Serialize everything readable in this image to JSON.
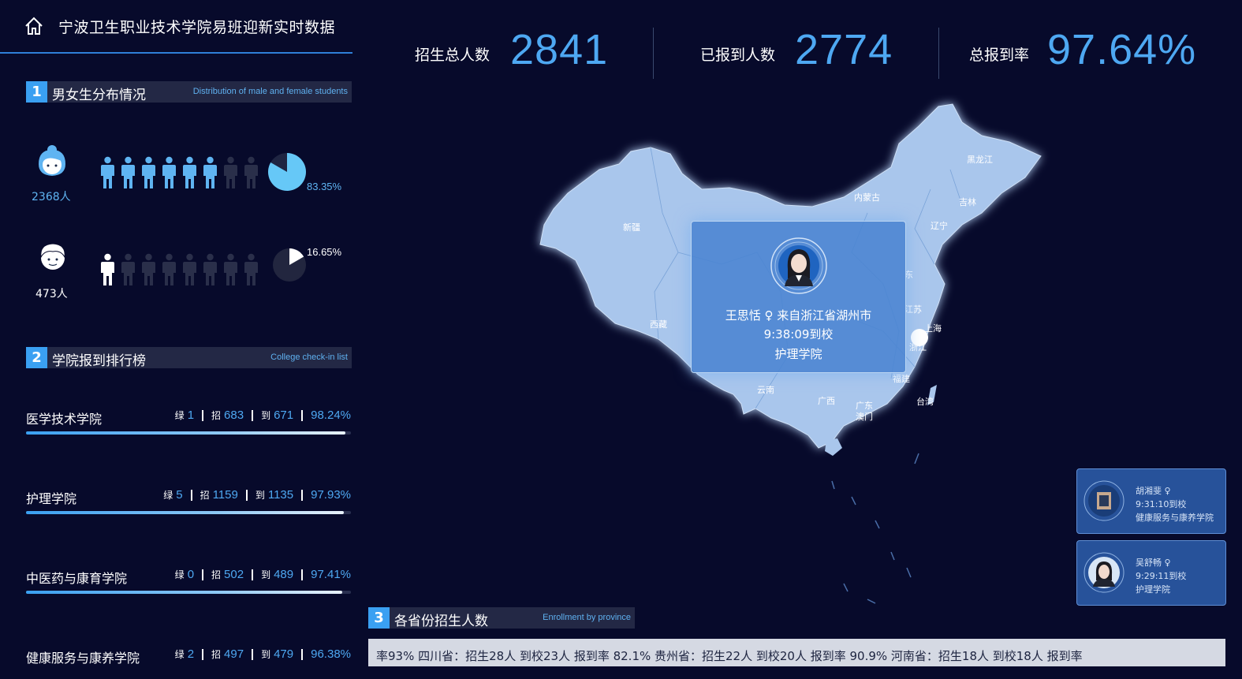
{
  "header": {
    "title": "宁波卫生职业技术学院易班迎新实时数据"
  },
  "kpis": [
    {
      "label": "招生总人数",
      "value": "2841"
    },
    {
      "label": "已报到人数",
      "value": "2774"
    },
    {
      "label": "总报到率",
      "value": "97.64%"
    }
  ],
  "section1": {
    "num": "1",
    "title": "男女生分布情况",
    "subtitle": "Distribution of male and female students"
  },
  "gender": {
    "female": {
      "count_text": "2368人",
      "percent_text": "83.35%",
      "percent": 83.35
    },
    "male": {
      "count_text": "473人",
      "percent_text": "16.65%",
      "percent": 16.65
    }
  },
  "section2": {
    "num": "2",
    "title": "学院报到排行榜",
    "subtitle": "College check-in list"
  },
  "colleges": [
    {
      "name": "医学技术学院",
      "k1": "绿",
      "v1": "1",
      "k2": "招",
      "v2": "683",
      "k3": "到",
      "v3": "671",
      "rate": "98.24%",
      "rate_value": 98.24
    },
    {
      "name": "护理学院",
      "k1": "绿",
      "v1": "5",
      "k2": "招",
      "v2": "1159",
      "k3": "到",
      "v3": "1135",
      "rate": "97.93%",
      "rate_value": 97.93
    },
    {
      "name": "中医药与康育学院",
      "k1": "绿",
      "v1": "0",
      "k2": "招",
      "v2": "502",
      "k3": "到",
      "v3": "489",
      "rate": "97.41%",
      "rate_value": 97.41
    },
    {
      "name": "健康服务与康养学院",
      "k1": "绿",
      "v1": "2",
      "k2": "招",
      "v2": "497",
      "k3": "到",
      "v3": "479",
      "rate": "96.38%",
      "rate_value": 96.38
    }
  ],
  "section3": {
    "num": "3",
    "title": "各省份招生人数",
    "subtitle": "Enrollment by province"
  },
  "map_labels": [
    "黑龙江",
    "吉林",
    "内蒙古",
    "辽宁",
    "新疆",
    "西藏",
    "江苏",
    "上海",
    "浙江",
    "福建",
    "台湾",
    "广东",
    "澳门",
    "广西",
    "云南",
    "东"
  ],
  "popup": {
    "name": "王思恬",
    "gender_symbol": "♀",
    "from_text": "来自浙江省湖州市",
    "time_text": "9:38:09到校",
    "college": "护理学院"
  },
  "cards": [
    {
      "name": "胡湘斐 ♀",
      "time": "9:31:10到校",
      "college": "健康服务与康养学院"
    },
    {
      "name": "吴舒畅 ♀",
      "time": "9:29:11到校",
      "college": "护理学院"
    }
  ],
  "marquee": {
    "text": "率93%     四川省：招生28人   到校23人   报到率 82.1%     贵州省：招生22人   到校20人   报到率 90.9%     河南省：招生18人   到校18人   报到率"
  },
  "icons": {
    "home": "home-icon",
    "female": "female-avatar-icon",
    "male": "male-avatar-icon",
    "person": "person-icon"
  },
  "colors": {
    "background": "#070a2b",
    "accent": "#4ea8f2",
    "section_badge": "#3aa0f2",
    "map_fill": "#a9c6ec",
    "popup": "#4a84d2",
    "pie_female": "#66c8f7",
    "pie_male": "#ffffff"
  }
}
